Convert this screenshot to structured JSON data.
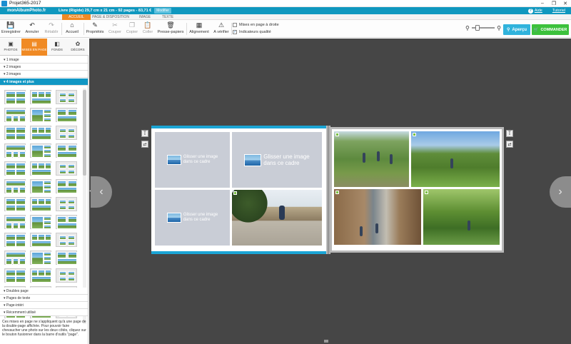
{
  "window": {
    "title": "Projet365-2017",
    "controls": {
      "minimize": "–",
      "maximize": "❐",
      "close": "✕"
    }
  },
  "brand": {
    "logo": "monAlbumPhoto.fr",
    "book_info": "Livre (Rigide) 29,7 cm x 21 cm - 92 pages - 83,71 €",
    "modify_label": "Modifier",
    "help_label": "Aide",
    "tutorial_label": "Tutoriel"
  },
  "tabs": [
    {
      "label": "ACCUEIL",
      "active": true
    },
    {
      "label": "PAGE & DISPOSITION",
      "active": false
    },
    {
      "label": "IMAGE",
      "active": false
    },
    {
      "label": "TEXTE",
      "active": false
    }
  ],
  "ribbon": {
    "save": "Enregistrer",
    "undo": "Annuler",
    "redo": "Rétablir",
    "home": "Accueil",
    "properties": "Propriétés",
    "cut": "Couper",
    "copy": "Copier",
    "paste": "Coller",
    "clipboard": "Presse-papiers",
    "align": "Alignement",
    "check": "A vérifier",
    "right_layout": "Mises en page à droite",
    "quality_indicators": "Indicateurs qualité",
    "right_layout_checked": false,
    "quality_checked": true,
    "preview": "Aperçu",
    "order": "COMMANDER"
  },
  "icons": {
    "save": "💾",
    "undo": "↶",
    "redo": "↷",
    "home": "⌂",
    "properties": "✎",
    "cut": "✂",
    "copy": "❐",
    "paste": "📋",
    "clipboard": "🗑",
    "align": "▦",
    "check": "⚠",
    "zoom_out": "⚲",
    "zoom_in": "⚲",
    "cart": "🛒",
    "nav_prev": "‹",
    "nav_next": "›",
    "text_tool": "Ṯ",
    "swap_tool": "⇄",
    "collapse": "◂"
  },
  "zoom": {
    "level": 0.2
  },
  "left_tabs": [
    {
      "label": "PHOTOS",
      "icon": "▣",
      "active": false
    },
    {
      "label": "MISES EN PAGE",
      "icon": "▤",
      "active": true
    },
    {
      "label": "FONDS",
      "icon": "◧",
      "active": false
    },
    {
      "label": "DÉCORS",
      "icon": "✿",
      "active": false
    }
  ],
  "accordion": {
    "one": "▾ 1 image",
    "two": "▾ 2 images",
    "three": "▾ 3 images",
    "four_plus": "▾ 4 images et plus",
    "double_page": "▾ Doubles page",
    "text_pages": "▾ Pages de texte",
    "separator": "▾ Page-intéri",
    "recent": "▾ Récemment utilisé"
  },
  "hint": "Ces mises en page ne s'appliquent qu'à une page de la double-page affichée. Pour pouvoir faire chevaucher une photo sur les deux côtés, cliquez sur le bouton fusionner dans la barre d'outils \"page\".",
  "placeholders": {
    "drop_text_line1": "Glisser une image",
    "drop_text_line2": "dans ce cadre"
  }
}
